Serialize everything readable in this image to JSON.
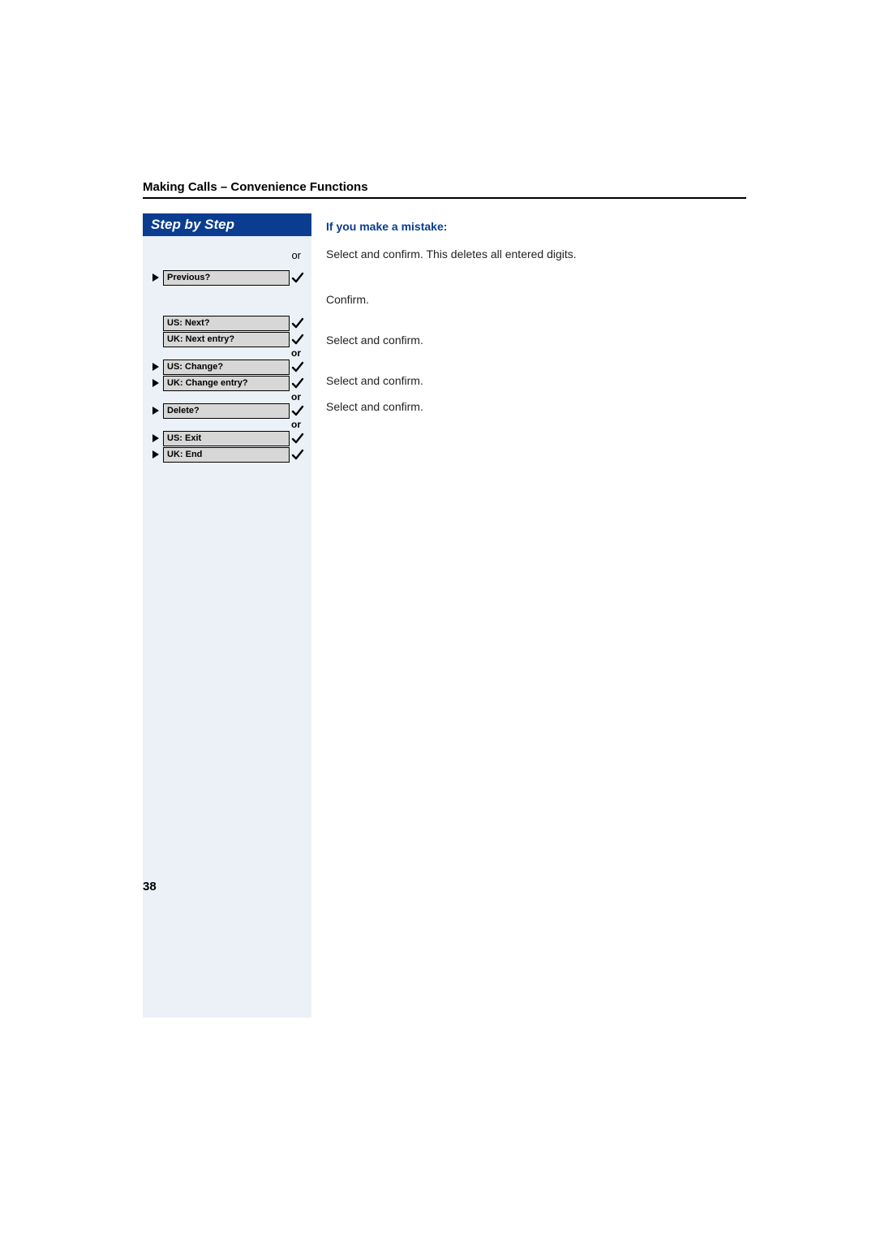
{
  "header": {
    "title": "Making Calls – Convenience Functions"
  },
  "sidebar": {
    "title": "Step by Step",
    "top_or": "or",
    "entries": {
      "previous": "Previous?",
      "us_next": "US: Next?",
      "uk_next_entry": "UK: Next entry?",
      "us_change": "US: Change?",
      "uk_change_entry": "UK: Change entry?",
      "delete": "Delete?",
      "us_exit": "US: Exit",
      "uk_end": "UK: End"
    },
    "or_label": "or"
  },
  "right": {
    "mistake_heading": "If you make a mistake:",
    "mistake_body": "Select and confirm. This deletes all entered digits.",
    "confirm": "Confirm.",
    "select_confirm_1": "Select and confirm.",
    "select_confirm_2": "Select and confirm.",
    "select_confirm_3": "Select and confirm."
  },
  "page_number": "38"
}
